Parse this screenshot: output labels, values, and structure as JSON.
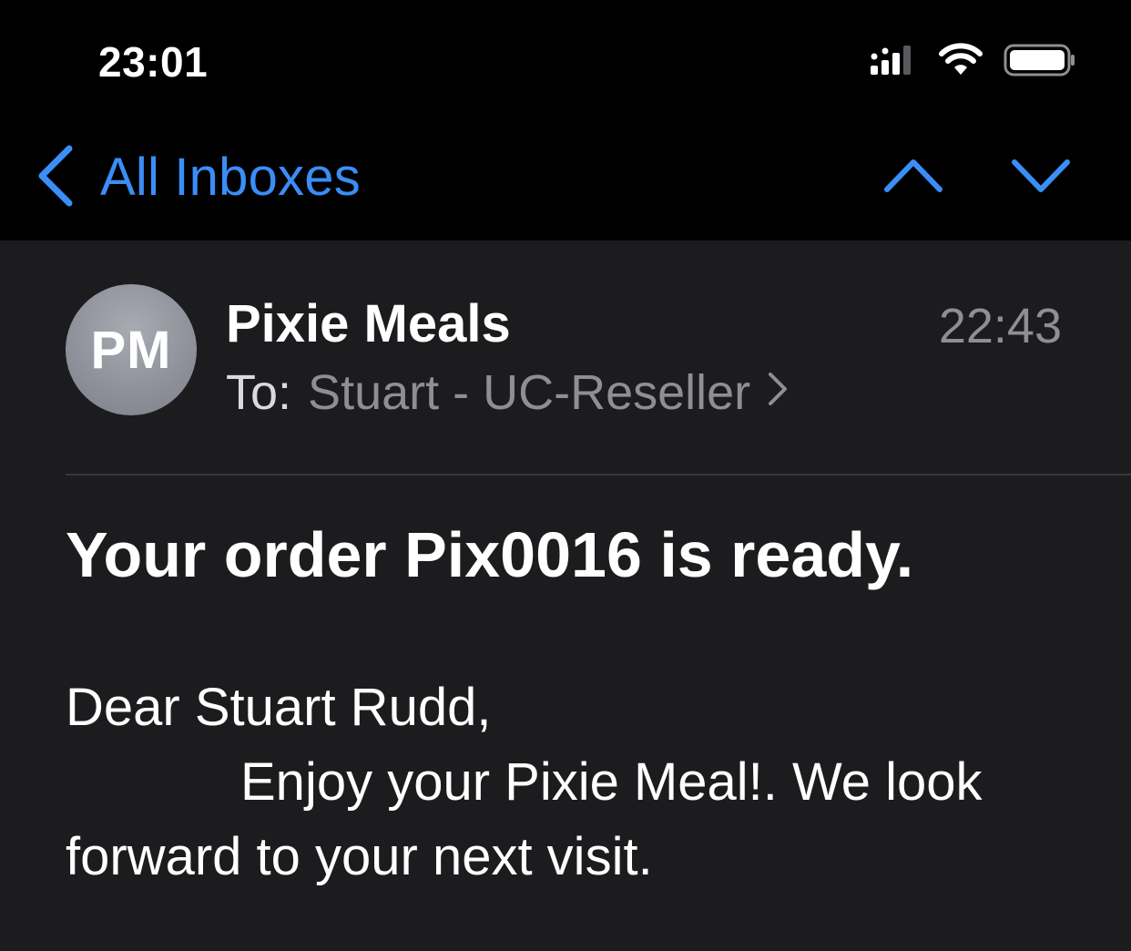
{
  "status_bar": {
    "time": "23:01",
    "icons": [
      "cellular-signal-icon",
      "wifi-icon",
      "battery-icon"
    ]
  },
  "nav": {
    "back_label": "All Inboxes",
    "accent_color": "#3a8ef6",
    "icons": [
      "chevron-left-icon",
      "chevron-up-icon",
      "chevron-down-icon"
    ]
  },
  "message": {
    "avatar_initials": "PM",
    "sender": "Pixie Meals",
    "time": "22:43",
    "to_label": "To:",
    "to_name": "Stuart - UC-Reseller",
    "subject": "Your order Pix0016 is ready.",
    "body": {
      "greeting": "Dear Stuart Rudd,",
      "line1": "Enjoy your Pixie Meal!. We look",
      "line2": "forward to your next visit."
    }
  }
}
